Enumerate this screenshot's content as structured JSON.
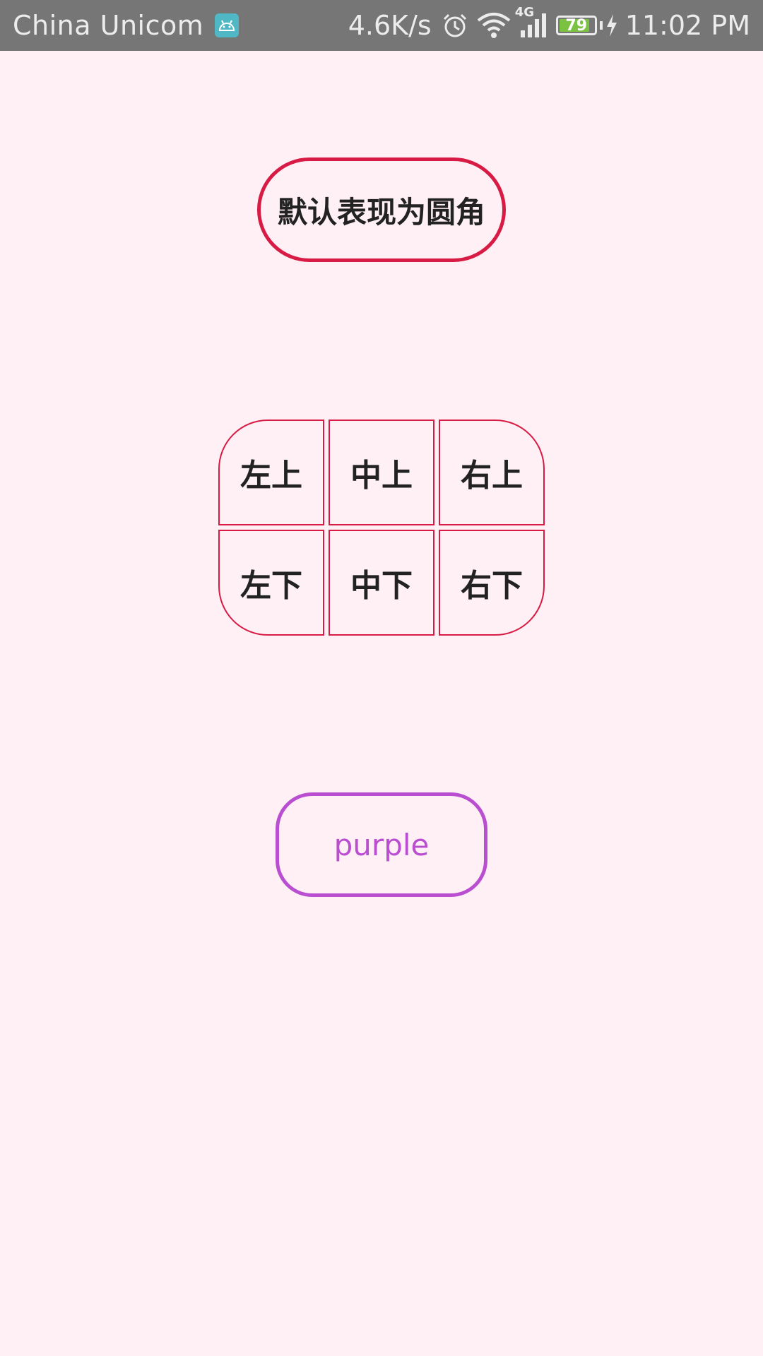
{
  "status_bar": {
    "carrier": "China Unicom",
    "network_speed": "4.6K/s",
    "network_type": "4G",
    "battery_level": "79",
    "time": "11:02 PM",
    "icons": [
      "android-icon",
      "alarm-icon",
      "wifi-icon",
      "signal-icon",
      "battery-icon",
      "charging-icon"
    ]
  },
  "main": {
    "default_button": "默认表现为圆角",
    "grid": {
      "top_left": "左上",
      "top_center": "中上",
      "top_right": "右上",
      "bottom_left": "左下",
      "bottom_center": "中下",
      "bottom_right": "右下"
    },
    "purple_button": "purple"
  },
  "colors": {
    "background": "#fff0f5",
    "status_bar": "#767676",
    "crimson": "#d81b45",
    "purple": "#b94fd0"
  }
}
